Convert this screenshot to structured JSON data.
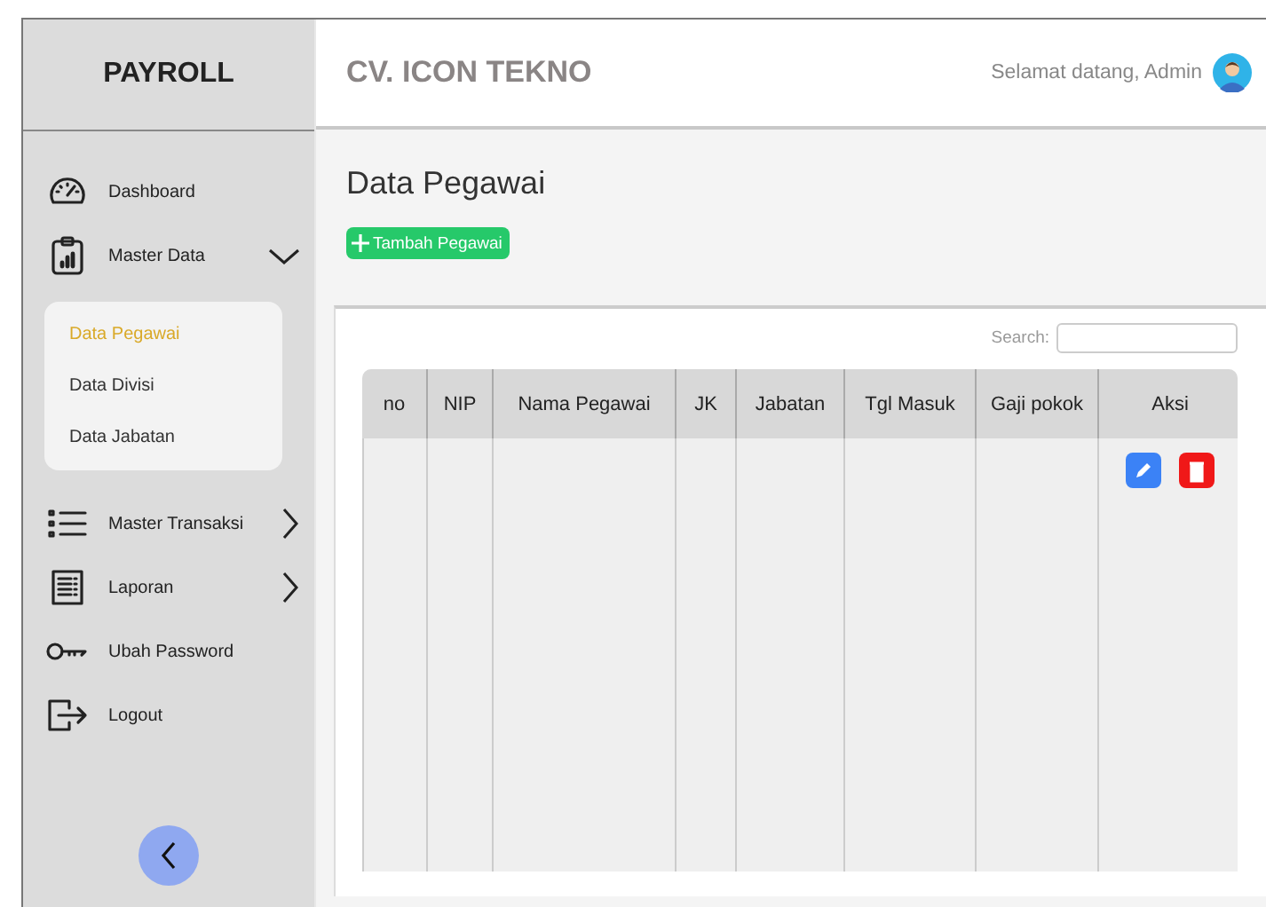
{
  "sidebar": {
    "brand": "PAYROLL",
    "items": [
      {
        "kind": "link",
        "label": "Dashboard"
      },
      {
        "kind": "group",
        "label": "Master Data",
        "expanded": true,
        "children": [
          {
            "label": "Data Pegawai",
            "selected": true
          },
          {
            "label": "Data Divisi",
            "selected": false
          },
          {
            "label": "Data Jabatan",
            "selected": false
          }
        ]
      },
      {
        "kind": "group",
        "label": "Master Transaksi",
        "expanded": false
      },
      {
        "kind": "group",
        "label": "Laporan",
        "expanded": false
      },
      {
        "kind": "link",
        "label": "Ubah Password"
      },
      {
        "kind": "link",
        "label": "Logout"
      }
    ]
  },
  "header": {
    "company": "CV. ICON TEKNO",
    "greeting": "Selamat datang, Admin"
  },
  "page": {
    "title": "Data Pegawai",
    "add_button": "Tambah Pegawai",
    "search": {
      "label": "Search:"
    },
    "table": {
      "columns": [
        "no",
        "NIP",
        "Nama Pegawai",
        "JK",
        "Jabatan",
        "Tgl Masuk",
        "Gaji pokok",
        "Aksi"
      ],
      "rows": [
        {
          "actions": [
            {
              "kind": "edit"
            },
            {
              "kind": "delete"
            }
          ]
        }
      ]
    }
  }
}
